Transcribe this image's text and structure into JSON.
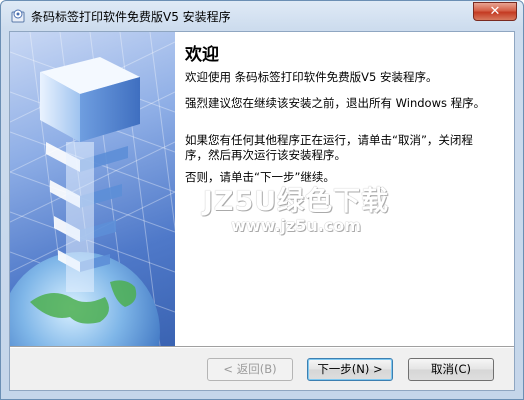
{
  "window": {
    "title": "条码标签打印软件免费版V5 安装程序"
  },
  "titlebar": {
    "close_glyph": "✕"
  },
  "content": {
    "heading": "欢迎",
    "paragraphs": [
      "欢迎使用 条码标签打印软件免费版V5  安装程序。",
      "强烈建议您在继续该安装之前，退出所有 Windows 程序。",
      "如果您有任何其他程序正在运行，请单击“取消”，关闭程序，然后再次运行该安装程序。",
      "否则，请单击“下一步”继续。"
    ]
  },
  "buttons": {
    "back": "< 返回(B)",
    "next": "下一步(N) >",
    "cancel": "取消(C)"
  },
  "watermark": {
    "line1": "JZ5U绿色下载",
    "line2": "www.jz5u.com"
  },
  "icons": {
    "app": "installer-icon",
    "close": "close-icon"
  },
  "colors": {
    "sidebar_blue": "#4f79c9",
    "close_red": "#c43a22"
  }
}
